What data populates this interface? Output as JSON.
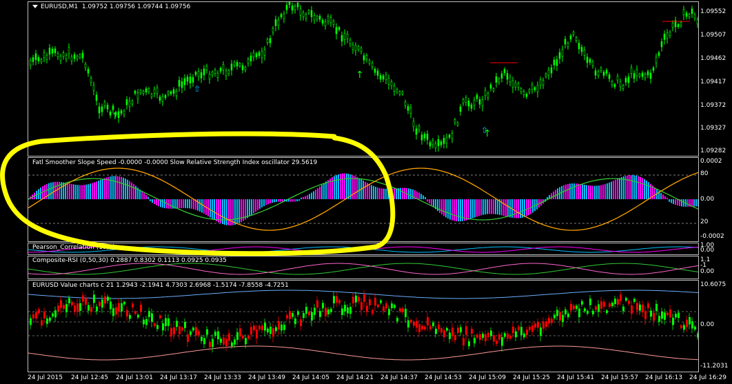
{
  "main_chart": {
    "symbol_label": "EURUSD,M1",
    "ohlc": "1.09752 1.09756 1.09744 1.09756",
    "price_scale": [
      "1.09552",
      "1.09507",
      "1.09462",
      "1.09417",
      "1.09372",
      "1.09327",
      "1.09282"
    ]
  },
  "fatl_panel": {
    "title": "Fatl Smoother Slope Speed -0.0000 -0.0000  Slow Relative Strength Index oscillator 29.5619",
    "scale": [
      "0.0002",
      "80",
      "0.00",
      "20",
      "-0.0002"
    ]
  },
  "pearson_panel": {
    "title": "Pearson_Correlation (19,2)",
    "scale": [
      "1.00",
      "0.00"
    ]
  },
  "composite_panel": {
    "title": "Composite-RSI (0,50,30) 0.2887 0.8302 0.1113 0.0925 0.0935",
    "scale": [
      "1.1",
      "-1",
      "0.00"
    ]
  },
  "value_panel": {
    "title": "EURUSD Value charts c 21 1.2943 -2.1941 4.7303 2.6968 -1.5174 -7.8558 -4.7251",
    "scale": [
      "10.6075",
      "0.00",
      "-11.2031"
    ]
  },
  "time_axis": [
    "24 Jul 2015",
    "24 Jul 12:45",
    "24 Jul 13:01",
    "24 Jul 13:17",
    "24 Jul 13:33",
    "24 Jul 13:49",
    "24 Jul 14:05",
    "24 Jul 14:21",
    "24 Jul 14:37",
    "24 Jul 14:53",
    "24 Jul 15:09",
    "24 Jul 15:25",
    "24 Jul 15:41",
    "24 Jul 15:57",
    "24 Jul 16:13",
    "24 Jul 16:29"
  ],
  "colors": {
    "bull": "#00ff00",
    "bear": "#ff0000",
    "highlight": "#ffff00",
    "aqua": "#00bfff",
    "magenta": "#ff00ff",
    "orange": "#ffa500"
  }
}
